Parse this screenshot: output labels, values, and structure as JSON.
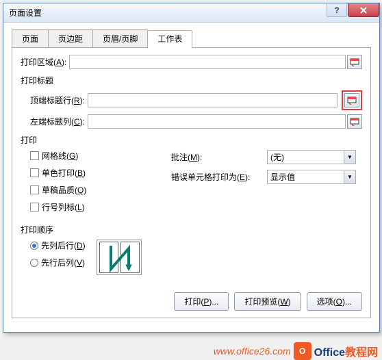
{
  "title": "页面设置",
  "tabs": {
    "page": "页面",
    "margins": "页边距",
    "headerfooter": "页眉/页脚",
    "sheet": "工作表"
  },
  "print_area": {
    "label": "打印区域(",
    "hotkey": "A",
    "suffix": "):",
    "value": ""
  },
  "print_titles": {
    "heading": "打印标题",
    "topRow": {
      "label": "顶端标题行(",
      "hotkey": "R",
      "suffix": "):",
      "value": ""
    },
    "leftCol": {
      "label": "左端标题列(",
      "hotkey": "C",
      "suffix": "):",
      "value": ""
    }
  },
  "print_opts": {
    "heading": "打印",
    "gridlines": {
      "label": "网格线(",
      "hotkey": "G",
      "suffix": ")"
    },
    "bw": {
      "label": "单色打印(",
      "hotkey": "B",
      "suffix": ")"
    },
    "draft": {
      "label": "草稿品质(",
      "hotkey": "Q",
      "suffix": ")"
    },
    "rowcol": {
      "label": "行号列标(",
      "hotkey": "L",
      "suffix": ")"
    },
    "comments": {
      "label": "批注(",
      "hotkey": "M",
      "suffix": "):",
      "value": "(无)"
    },
    "errors": {
      "label": "错误单元格打印为(",
      "hotkey": "E",
      "suffix": "):",
      "value": "显示值"
    }
  },
  "order": {
    "heading": "打印顺序",
    "downover": {
      "label": "先列后行(",
      "hotkey": "D",
      "suffix": ")"
    },
    "overdown": {
      "label": "先行后列(",
      "hotkey": "V",
      "suffix": ")"
    }
  },
  "buttons": {
    "print": {
      "label": "打印(",
      "hotkey": "P",
      "suffix": ")..."
    },
    "preview": {
      "label": "打印预览(",
      "hotkey": "W",
      "suffix": ")"
    },
    "options": {
      "label": "选项(",
      "hotkey": "O",
      "suffix": ")..."
    }
  },
  "watermark": {
    "url": "www.office26.com",
    "brand1": "Office",
    "brand2": "教程网"
  }
}
